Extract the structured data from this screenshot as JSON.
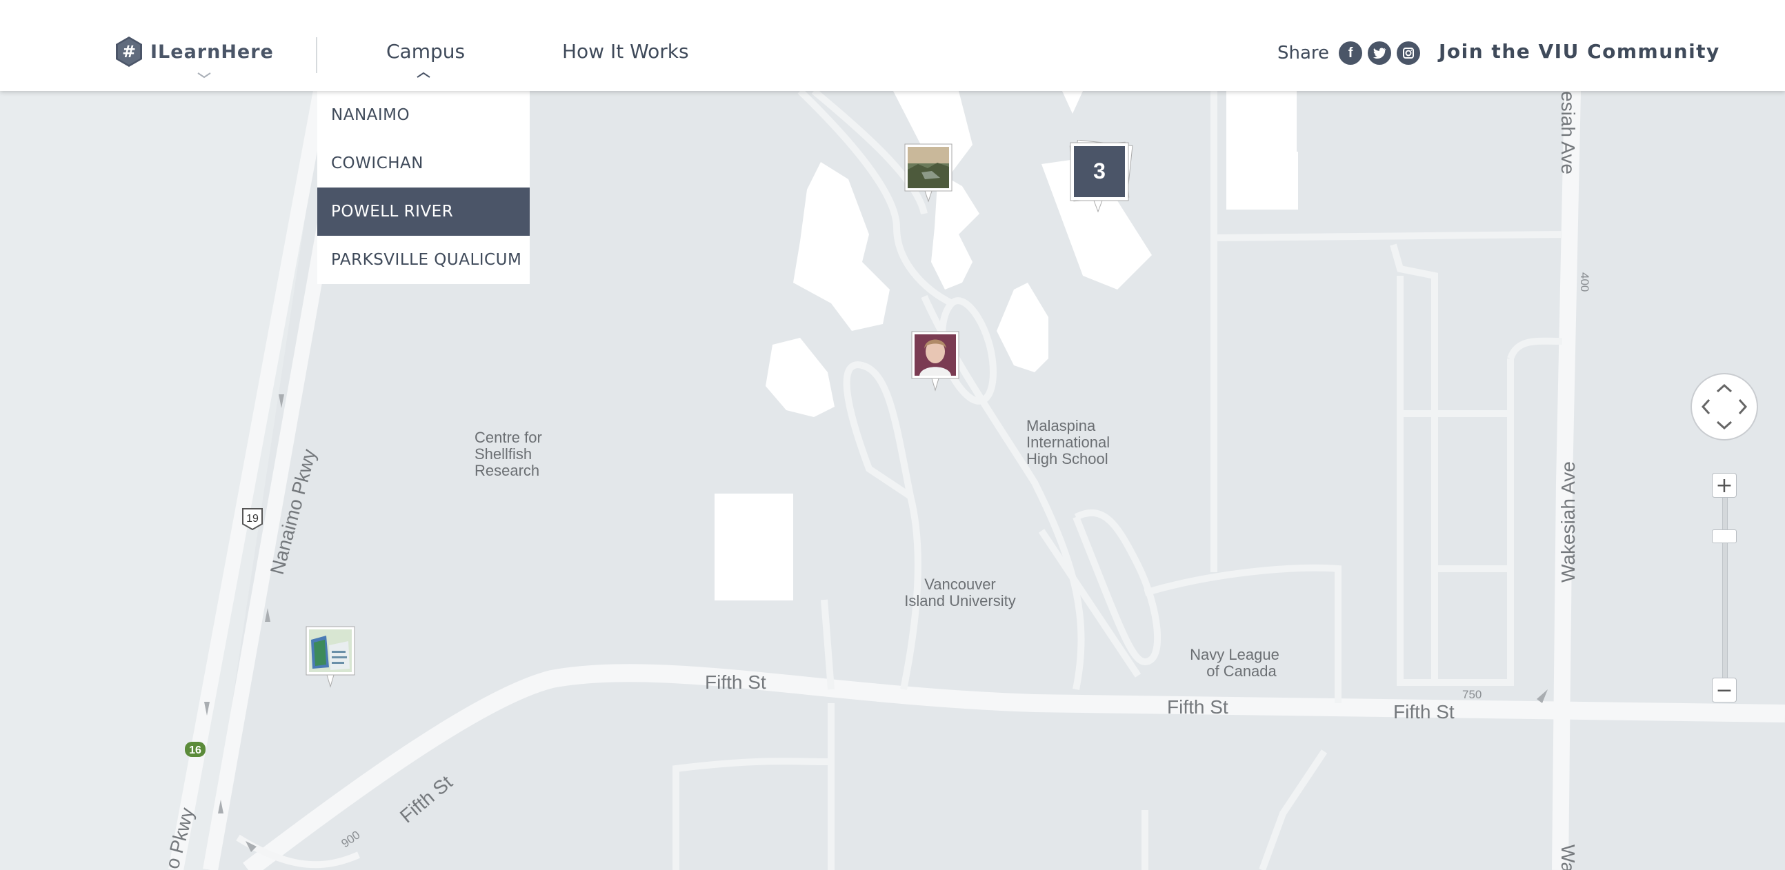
{
  "header": {
    "logo_text": "ILearnHere",
    "nav": {
      "campus": "Campus",
      "how_it_works": "How It Works"
    },
    "share_label": "Share",
    "social": [
      "facebook-icon",
      "twitter-icon",
      "instagram-icon"
    ],
    "join_label": "Join the VIU Community"
  },
  "campus_menu": {
    "items": [
      "NANAIMO",
      "COWICHAN",
      "POWELL RIVER",
      "PARKSVILLE QUALICUM"
    ],
    "active": "POWELL RIVER"
  },
  "map": {
    "labels": {
      "centre_shellfish": [
        "Centre for",
        "Shellfish",
        "Research"
      ],
      "malaspina": [
        "Malaspina",
        "International",
        "High School"
      ],
      "viu": [
        "Vancouver",
        "Island University"
      ],
      "navy_league": [
        "Navy League",
        "of Canada"
      ],
      "fifth_st": "Fifth St",
      "nanaimo_pkwy": "Nanaimo Pkwy",
      "nanaimo_pkwy_partial": "o Pkwy",
      "wakesiah_ave": "Wakesiah Ave",
      "wakesiah_top": "esiah Ave",
      "wakesiah_bottom": "Wa",
      "n750": "750",
      "n900": "900",
      "n400": "400",
      "route19": "19",
      "route16": "16"
    },
    "cluster_count": "3"
  },
  "controls": {
    "zoom_in": "+",
    "zoom_out": "−"
  },
  "colors": {
    "header_bg": "#ffffff",
    "nav_text": "#3f4a5a",
    "active_menu_bg": "#4b5568",
    "map_land": "#e3e7ea",
    "road": "#f7f8f8"
  }
}
